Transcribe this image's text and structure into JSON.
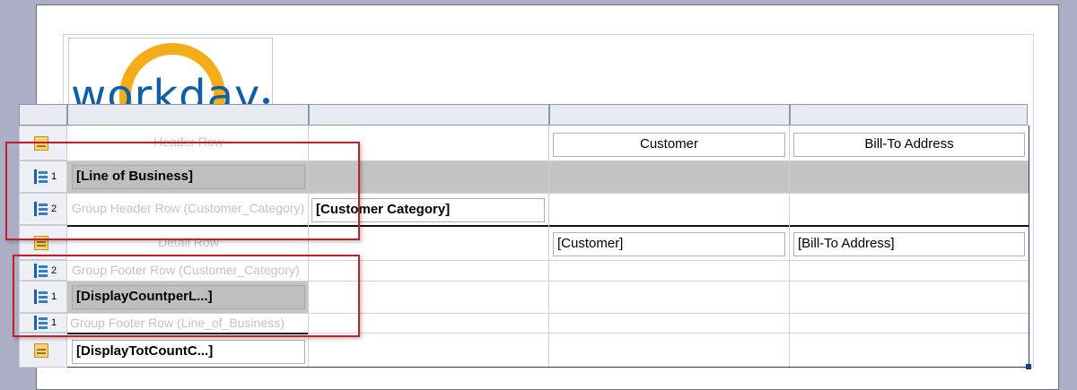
{
  "report": {
    "logo_text": "workday"
  },
  "tablix": {
    "header_row": {
      "label": "Header Row",
      "customer": "Customer",
      "bill_to": "Bill-To Address"
    },
    "group1_header": {
      "level": "1",
      "field": "[Line of Business]"
    },
    "group2_header": {
      "level": "2",
      "label": "Group Header Row (Customer_Category)",
      "field": "[Customer Category]"
    },
    "detail_row": {
      "label": "Detail Row",
      "customer": "[Customer]",
      "bill_to": "[Bill-To Address]"
    },
    "group2_footer": {
      "level": "2",
      "label": "Group Footer Row (Customer_Category)"
    },
    "group1_footer_a": {
      "level": "1",
      "field": "[DisplayCountperL...]"
    },
    "group1_footer_b": {
      "level": "1",
      "label": "Group Footer Row (Line_of_Business)"
    },
    "total_row": {
      "field": "[DisplayTotCountC...]"
    }
  },
  "colors": {
    "background": "#abaec4",
    "highlight": "#c0202a",
    "group_band": "#c4c4c4",
    "logo_blue": "#0e5fa8",
    "logo_orange": "#f3ad1b"
  }
}
